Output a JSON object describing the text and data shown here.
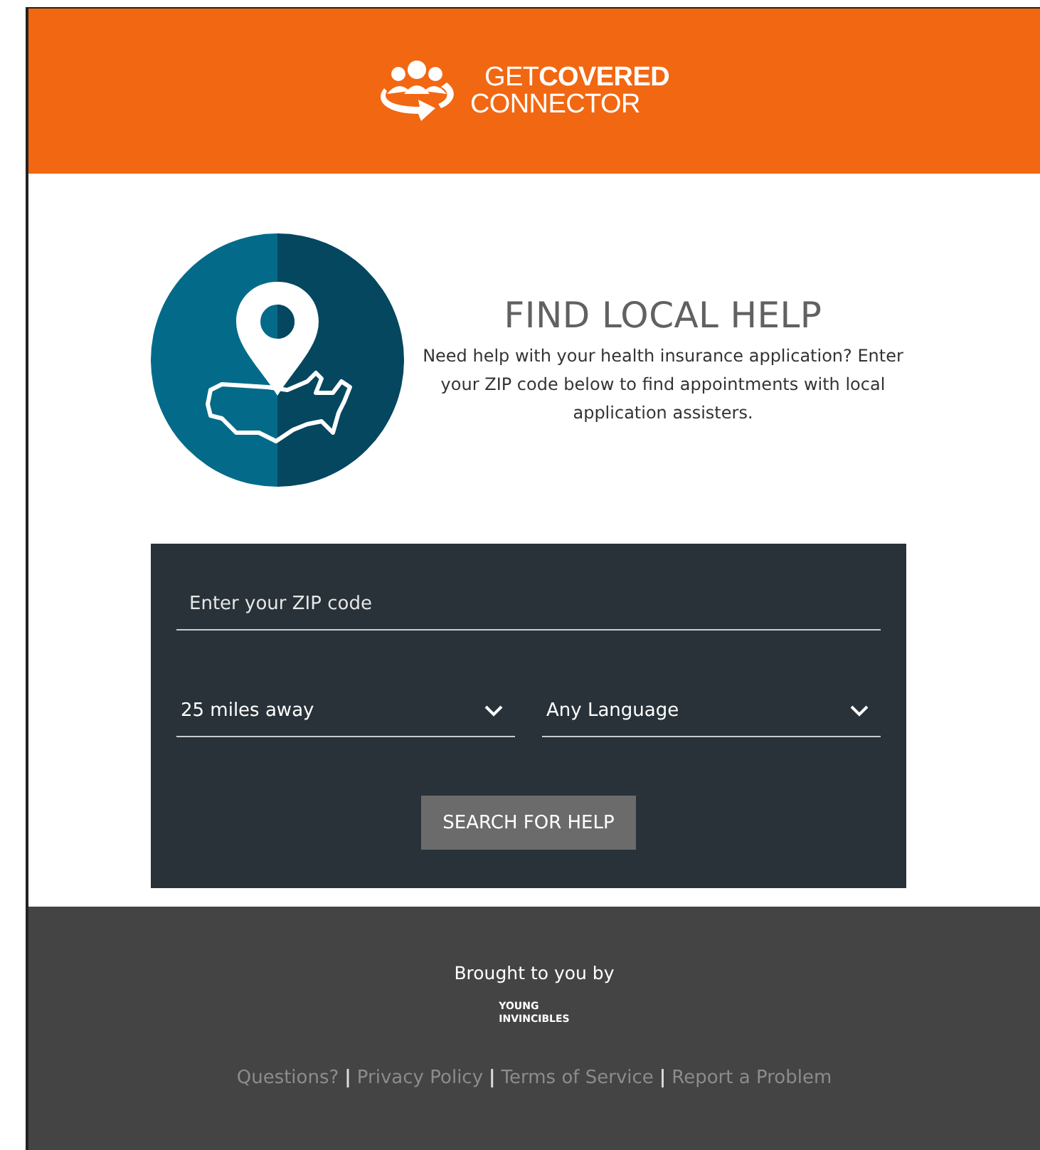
{
  "header": {
    "logo_line_1": "GET**COVERED**",
    "logo_line_2": "CONNECTOR"
  },
  "intro": {
    "title": "FIND LOCAL HELP",
    "text": "Need help with your health insurance application? Enter your ZIP code below to find appointments with local application assisters."
  },
  "search_form": {
    "zip": {
      "placeholder": "Enter your ZIP code"
    },
    "dropdowns": [
      {
        "value": "25 miles away"
      },
      {
        "value": "Any Language"
      }
    ],
    "button": "SEARCH FOR HELP"
  },
  "footer": {
    "credit": "Brought to you by",
    "sponsor_line_1": "YOUNG",
    "sponsor_line_2": "INVINCIBLES",
    "links": [
      {
        "label": "Questions?"
      },
      {
        "label": "Privacy Policy"
      },
      {
        "label": "Terms of Service"
      },
      {
        "label": "Report a Problem"
      }
    ],
    "separators": [
      "|",
      "|",
      "|"
    ]
  }
}
